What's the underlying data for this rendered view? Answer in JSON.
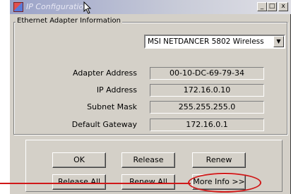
{
  "window": {
    "title": "IP Configuration",
    "controls": {
      "minimize": "_",
      "maximize": "□",
      "close": "x"
    }
  },
  "adapter_group": {
    "label": "Ethernet Adapter Information",
    "selected_adapter": "MSI NETDANCER 5802 Wireless",
    "fields": [
      {
        "label": "Adapter Address",
        "value": "00-10-DC-69-79-34"
      },
      {
        "label": "IP Address",
        "value": "172.16.0.10"
      },
      {
        "label": "Subnet Mask",
        "value": "255.255.255.0"
      },
      {
        "label": "Default Gateway",
        "value": "172.16.0.1"
      }
    ]
  },
  "buttons": {
    "ok": "OK",
    "release": "Release",
    "renew": "Renew",
    "release_all": "Release All",
    "renew_all": "Renew All",
    "more_info": "More Info >>"
  },
  "annotation": {
    "color": "#d01818"
  }
}
